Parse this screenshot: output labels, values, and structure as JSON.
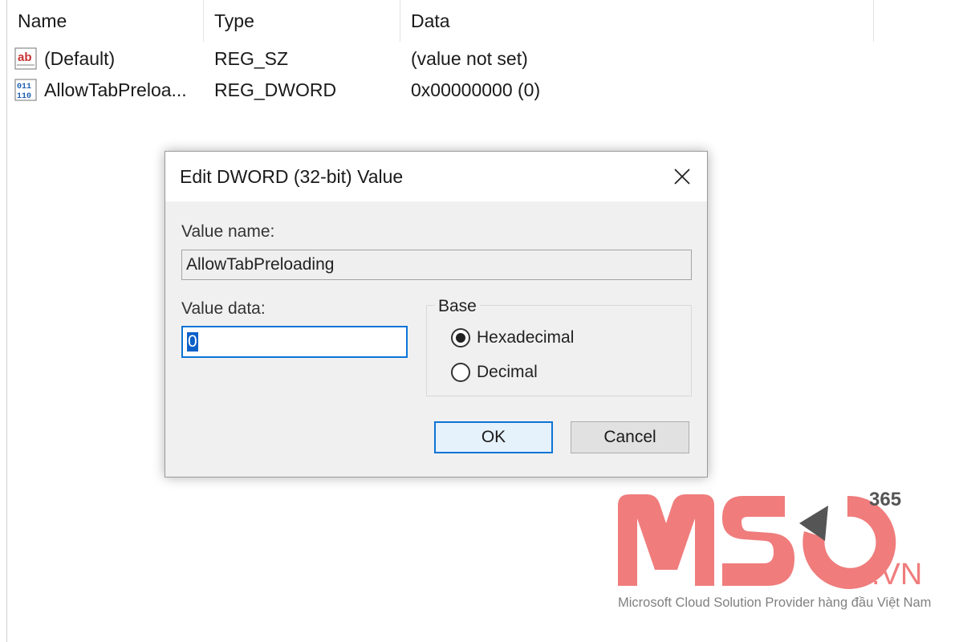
{
  "registry_list": {
    "columns": [
      "Name",
      "Type",
      "Data"
    ],
    "rows": [
      {
        "icon": "string-value-icon",
        "name": "(Default)",
        "type": "REG_SZ",
        "data": "(value not set)"
      },
      {
        "icon": "binary-dword-icon",
        "name": "AllowTabPreloa...",
        "type": "REG_DWORD",
        "data": "0x00000000 (0)"
      }
    ]
  },
  "dialog": {
    "title": "Edit DWORD (32-bit) Value",
    "close_icon": "close-icon",
    "value_name_label": "Value name:",
    "value_name": "AllowTabPreloading",
    "value_data_label": "Value data:",
    "value_data": "0",
    "base_label": "Base",
    "base_options": [
      {
        "label": "Hexadecimal",
        "selected": true
      },
      {
        "label": "Decimal",
        "selected": false
      }
    ],
    "ok_label": "OK",
    "cancel_label": "Cancel"
  },
  "watermark": {
    "brand": "MSO",
    "superscript": "365",
    "suffix": ".VN",
    "tagline": "Microsoft Cloud Solution Provider hàng đầu Việt Nam",
    "brand_color": "#f07c7c",
    "accent_color": "#555555"
  },
  "colors": {
    "focus_blue": "#0b74d6",
    "selection_blue": "#0b60c8",
    "dialog_bg": "#f0f0f0"
  }
}
